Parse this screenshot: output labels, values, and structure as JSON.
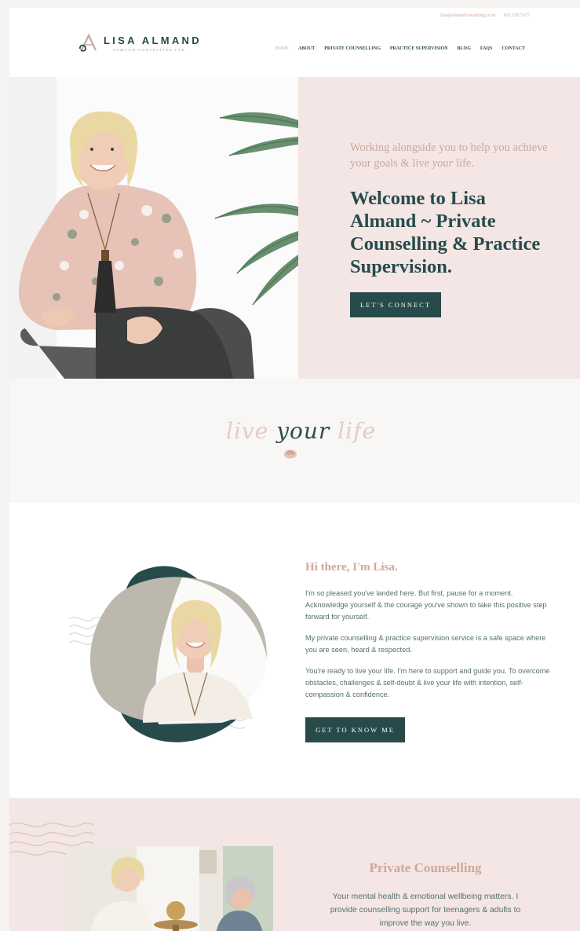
{
  "header": {
    "email": "lisa@almandconsulting.co.nz",
    "phone": "021 220 5377",
    "logo_name": "LISA ALMAND",
    "logo_sub": "ALMAND CONSULTING LTD",
    "nav": [
      "HOME",
      "ABOUT",
      "PRIVATE COUNSELLING",
      "PRACTICE SUPERVISION",
      "BLOG",
      "FAQS",
      "CONTACT"
    ],
    "active_nav": "HOME"
  },
  "hero": {
    "tagline_before": "Working alongside you to help you achieve your goals & live ",
    "tagline_em": "your",
    "tagline_after": " life.",
    "title": "Welcome to Lisa Almand ~ Private Counselling & Practice Supervision.",
    "button": "LET'S CONNECT"
  },
  "band": {
    "script_1": "live",
    "script_2": "your",
    "script_3": "life"
  },
  "about": {
    "title": "Hi there, I'm Lisa.",
    "p1": "I'm so pleased you've landed here. But first, pause for a moment. Acknowledge yourself & the courage you've shown to take this positive step forward for yourself.",
    "p2": "My private counselling & practice supervision service is a safe space where you are seen, heard & respected.",
    "p3": "You're ready to live your life. I'm here to support and guide you. To overcome obstacles, challenges & self-doubt & live your life with intention, self-compassion & confidence.",
    "button": "GET TO KNOW ME"
  },
  "services": {
    "title": "Private Counselling",
    "text": "Your mental health & emotional wellbeing matters. I provide counselling support for teenagers & adults to improve the way you live."
  },
  "colors": {
    "teal": "#274b4b",
    "blush": "#f3e6e4",
    "rose": "#d2a79a"
  }
}
